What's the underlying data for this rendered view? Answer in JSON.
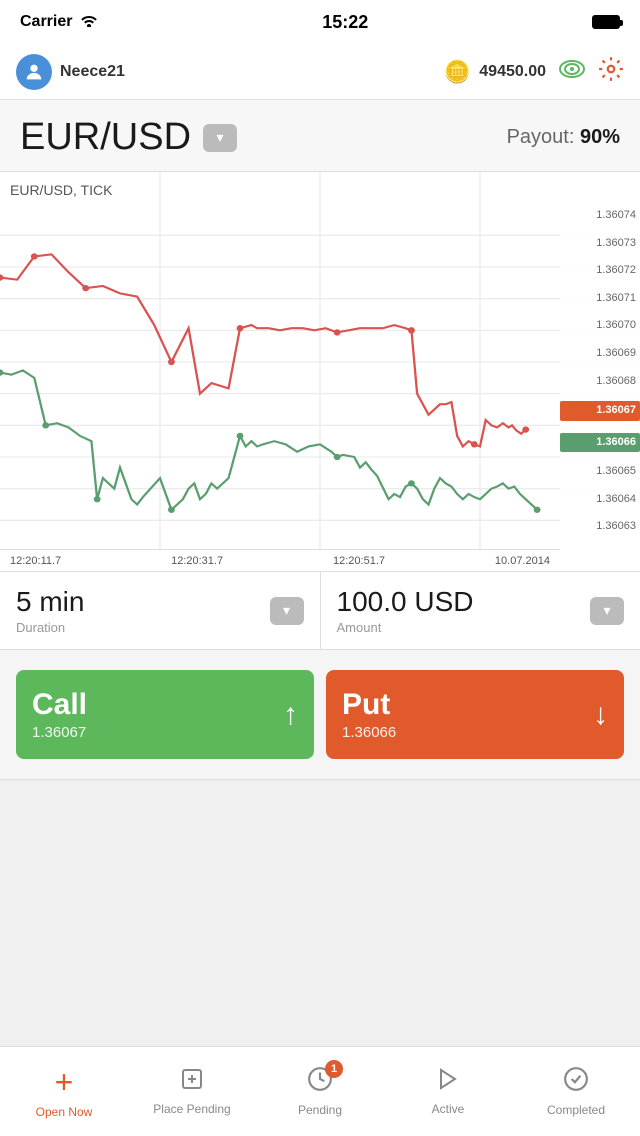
{
  "statusBar": {
    "carrier": "Carrier",
    "time": "15:22"
  },
  "header": {
    "username": "Neece21",
    "balance": "49450.00"
  },
  "symbol": {
    "name": "EUR/USD",
    "dropdown_label": "▾",
    "payout_label": "Payout:",
    "payout_value": "90%"
  },
  "chart": {
    "title": "EUR/USD, TICK",
    "prices": [
      "1.36074",
      "1.36073",
      "1.36072",
      "1.36071",
      "1.36070",
      "1.36069",
      "1.36068",
      "1.36067",
      "1.36066",
      "1.36065",
      "1.36064",
      "1.36063"
    ],
    "highlight_red": "1.36067",
    "highlight_green": "1.36066",
    "time_labels": [
      "12:20:11.7",
      "12:20:31.7",
      "12:20:51.7"
    ],
    "date_label": "10.07.2014"
  },
  "duration": {
    "value": "5 min",
    "label": "Duration"
  },
  "amount": {
    "value": "100.0 USD",
    "label": "Amount"
  },
  "callButton": {
    "label": "Call",
    "price": "1.36067",
    "arrow": "↑"
  },
  "putButton": {
    "label": "Put",
    "price": "1.36066",
    "arrow": "↓"
  },
  "tabs": [
    {
      "id": "open-now",
      "label": "Open Now",
      "icon": "+",
      "active": true
    },
    {
      "id": "place-pending",
      "label": "Place Pending",
      "icon": "☐+",
      "active": false
    },
    {
      "id": "pending",
      "label": "Pending",
      "icon": "🕐",
      "active": false,
      "badge": "1"
    },
    {
      "id": "active",
      "label": "Active",
      "icon": "▷",
      "active": false
    },
    {
      "id": "completed",
      "label": "Completed",
      "icon": "✓",
      "active": false
    }
  ],
  "colors": {
    "call_green": "#5db85c",
    "put_red": "#e05a2b",
    "highlight_red": "#e05a2b",
    "highlight_green": "#4a8a5e"
  }
}
